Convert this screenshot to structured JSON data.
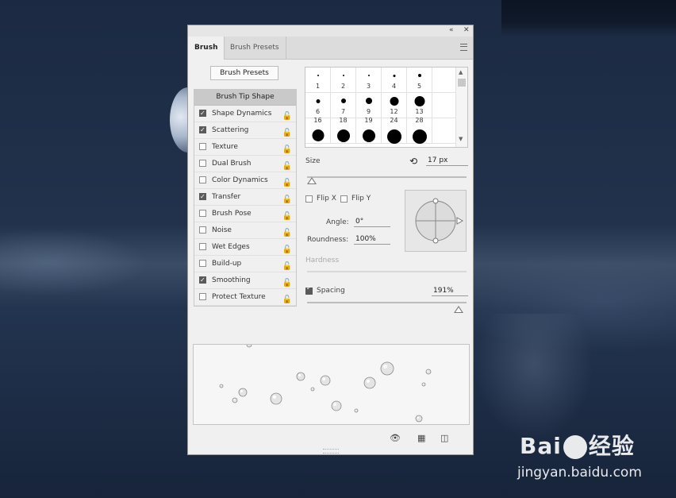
{
  "panel": {
    "tabs": [
      {
        "label": "Brush"
      },
      {
        "label": "Brush Presets"
      }
    ],
    "brush_presets_button": "Brush Presets",
    "options_header": "Brush Tip Shape",
    "options": [
      {
        "label": "Shape Dynamics",
        "checked": true
      },
      {
        "label": "Scattering",
        "checked": true
      },
      {
        "label": "Texture",
        "checked": false
      },
      {
        "label": "Dual Brush",
        "checked": false
      },
      {
        "label": "Color Dynamics",
        "checked": false
      },
      {
        "label": "Transfer",
        "checked": true
      },
      {
        "label": "Brush Pose",
        "checked": false
      },
      {
        "label": "Noise",
        "checked": false
      },
      {
        "label": "Wet Edges",
        "checked": false
      },
      {
        "label": "Build-up",
        "checked": false
      },
      {
        "label": "Smoothing",
        "checked": true
      },
      {
        "label": "Protect Texture",
        "checked": false
      }
    ],
    "tips": [
      "1",
      "2",
      "3",
      "4",
      "5",
      "6",
      "7",
      "9",
      "12",
      "13",
      "16",
      "18",
      "19",
      "24",
      "28"
    ],
    "size": {
      "label": "Size",
      "value": "17 px",
      "level": 0.03
    },
    "flip_x": {
      "label": "Flip X",
      "checked": false
    },
    "flip_y": {
      "label": "Flip Y",
      "checked": false
    },
    "angle": {
      "label": "Angle:",
      "value": "0°"
    },
    "roundness": {
      "label": "Roundness:",
      "value": "100%"
    },
    "hardness": {
      "label": "Hardness"
    },
    "spacing": {
      "label": "Spacing",
      "value": "191%",
      "checked": true,
      "level": 0.95
    }
  },
  "watermark": {
    "brand": "Bai",
    "brand_cn": "经验",
    "url": "jingyan.baidu.com"
  }
}
